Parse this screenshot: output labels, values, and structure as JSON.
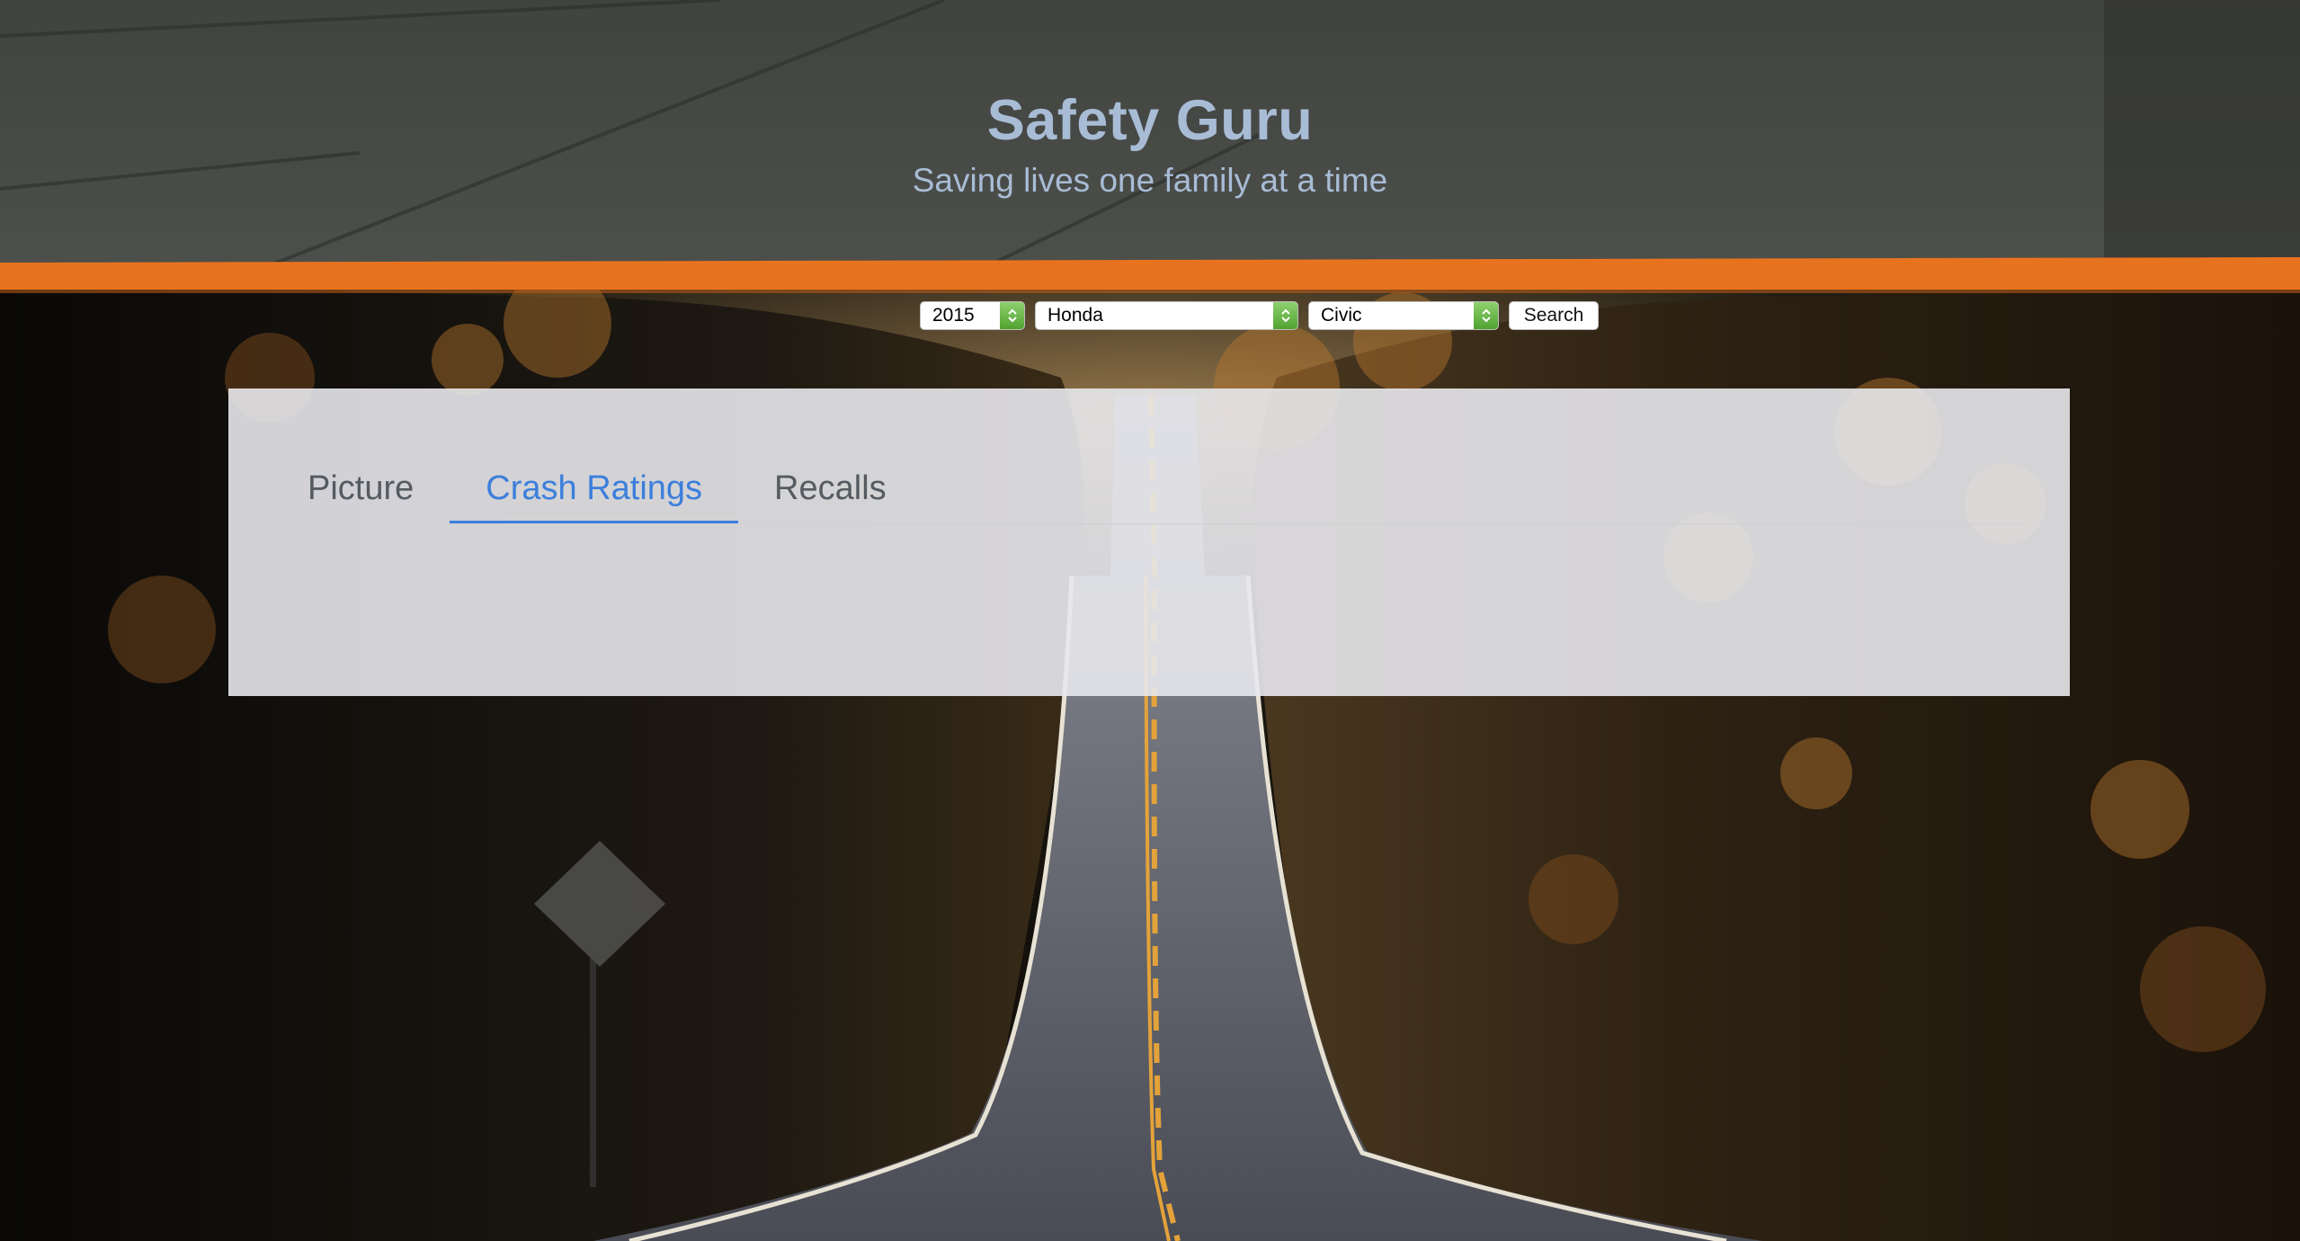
{
  "header": {
    "title": "Safety Guru",
    "subtitle": "Saving lives one family at a time"
  },
  "search": {
    "year": "2015",
    "make": "Honda",
    "model": "Civic",
    "button_label": "Search"
  },
  "tabs": [
    {
      "label": "Picture",
      "active": false
    },
    {
      "label": "Crash Ratings",
      "active": true
    },
    {
      "label": "Recalls",
      "active": false
    }
  ],
  "colors": {
    "title": "#a8bcd6",
    "accent_stripe": "#e8731e",
    "active_tab": "#3c7fdc",
    "stepper": "#5db33a"
  },
  "icons": {
    "stepper": "up-down-chevron-icon"
  }
}
